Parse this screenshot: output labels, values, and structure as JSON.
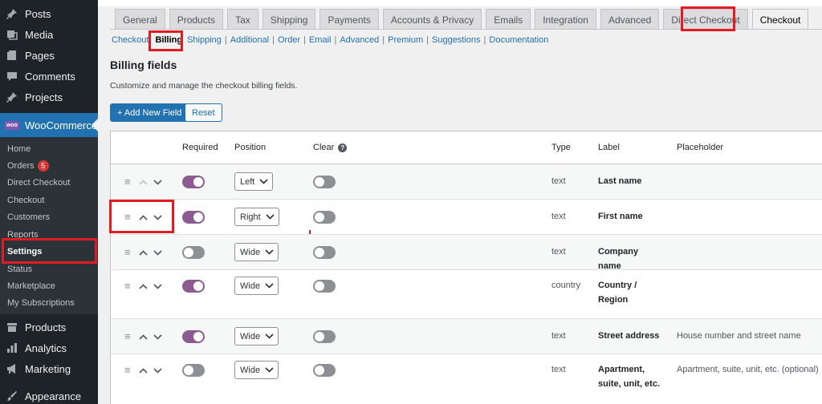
{
  "sidebar": {
    "items": [
      {
        "label": "Posts",
        "icon": "pin-icon"
      },
      {
        "label": "Media",
        "icon": "media-icon"
      },
      {
        "label": "Pages",
        "icon": "pages-icon"
      },
      {
        "label": "Comments",
        "icon": "comment-icon"
      },
      {
        "label": "Projects",
        "icon": "pin-icon"
      }
    ],
    "woocommerce": {
      "label": "WooCommerce",
      "badge": "woo"
    },
    "submenu": [
      {
        "label": "Home"
      },
      {
        "label": "Orders",
        "count": "5"
      },
      {
        "label": "Direct Checkout"
      },
      {
        "label": "Checkout"
      },
      {
        "label": "Customers"
      },
      {
        "label": "Reports"
      },
      {
        "label": "Settings"
      },
      {
        "label": "Status"
      },
      {
        "label": "Marketplace"
      },
      {
        "label": "My Subscriptions"
      }
    ],
    "bottom": [
      {
        "label": "Products",
        "icon": "archive-icon"
      },
      {
        "label": "Analytics",
        "icon": "chart-icon"
      },
      {
        "label": "Marketing",
        "icon": "megaphone-icon"
      },
      {
        "label": "Appearance",
        "icon": "brush-icon"
      }
    ]
  },
  "tabs": [
    "General",
    "Products",
    "Tax",
    "Shipping",
    "Payments",
    "Accounts & Privacy",
    "Emails",
    "Integration",
    "Advanced",
    "Direct Checkout",
    "Checkout"
  ],
  "active_tab": "Checkout",
  "sublinks": [
    "Checkout",
    "Billing",
    "Shipping",
    "Additional",
    "Order",
    "Email",
    "Advanced",
    "Premium",
    "Suggestions",
    "Documentation"
  ],
  "active_sublink": "Billing",
  "page": {
    "title": "Billing fields",
    "description": "Customize and manage the checkout billing fields.",
    "add_button": "+ Add New Field",
    "reset_button": "Reset"
  },
  "table": {
    "headers": {
      "required": "Required",
      "position": "Position",
      "clear": "Clear",
      "type": "Type",
      "label": "Label",
      "placeholder": "Placeholder"
    },
    "rows": [
      {
        "required": true,
        "position": "Left",
        "clear": false,
        "type": "text",
        "label": "Last name",
        "placeholder": ""
      },
      {
        "required": true,
        "position": "Right",
        "clear": false,
        "type": "text",
        "label": "First name",
        "placeholder": ""
      },
      {
        "required": false,
        "position": "Wide",
        "clear": false,
        "type": "text",
        "label": "Company name",
        "placeholder": ""
      },
      {
        "required": true,
        "position": "Wide",
        "clear": false,
        "type": "country",
        "label": "Country / Region",
        "placeholder": ""
      },
      {
        "required": true,
        "position": "Wide",
        "clear": false,
        "type": "text",
        "label": "Street address",
        "placeholder": "House number and street name"
      },
      {
        "required": false,
        "position": "Wide",
        "clear": false,
        "type": "text",
        "label": "Apartment, suite, unit, etc.",
        "placeholder": "Apartment, suite, unit, etc. (optional)"
      }
    ]
  },
  "colors": {
    "sidebar": "#1d2327",
    "accent": "#2271b1",
    "toggle_on": "#8c5b92",
    "highlight": "#e01b24"
  }
}
